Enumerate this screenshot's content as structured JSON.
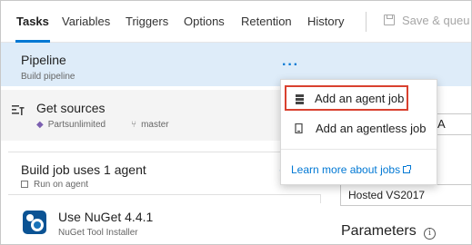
{
  "tabs": [
    {
      "label": "Tasks",
      "active": true
    },
    {
      "label": "Variables",
      "active": false
    },
    {
      "label": "Triggers",
      "active": false
    },
    {
      "label": "Options",
      "active": false
    },
    {
      "label": "Retention",
      "active": false
    },
    {
      "label": "History",
      "active": false
    }
  ],
  "toolbar": {
    "save_label": "Save & queu"
  },
  "pipeline": {
    "title": "Pipeline",
    "subtitle": "Build pipeline",
    "more_icon": "more-ellipsis-icon"
  },
  "sources": {
    "title": "Get sources",
    "repo": "Partsunlimited",
    "branch": "master"
  },
  "job": {
    "title": "Build job uses 1 agent",
    "subtitle": "Run on agent",
    "add_symbol": "+"
  },
  "task": {
    "title": "Use NuGet 4.4.1",
    "subtitle": "NuGet Tool Installer"
  },
  "right_pane": {
    "partial_letter": "A",
    "agent_pool_value": "Hosted VS2017",
    "parameters_label": "Parameters",
    "info_symbol": "i"
  },
  "menu": {
    "items": [
      {
        "label": "Add an agent job",
        "icon": "agent-job-icon",
        "highlighted": true
      },
      {
        "label": "Add an agentless job",
        "icon": "agentless-job-icon",
        "highlighted": false
      }
    ],
    "link": "Learn more about jobs"
  },
  "colors": {
    "accent": "#0078d4",
    "selection_bg": "#deecf9",
    "highlight_border": "#d9412f"
  }
}
